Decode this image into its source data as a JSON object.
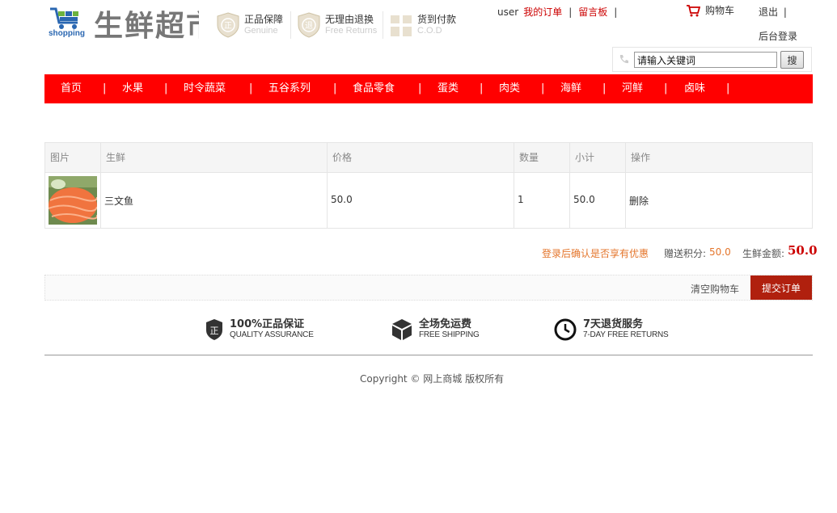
{
  "header": {
    "logo_en": "shopping",
    "logo_cn": "生鲜超市",
    "promises": [
      {
        "cn": "正品保障",
        "en": "Genuine",
        "icon": "shield-zheng-icon"
      },
      {
        "cn": "无理由退换",
        "en": "Free Returns",
        "icon": "shield-tui-icon"
      },
      {
        "cn": "货到付款",
        "en": "C.O.D",
        "icon": "gift-box-icon"
      }
    ],
    "user": "user",
    "my_orders": "我的订单",
    "message_board": "留言板",
    "sep": "|",
    "cart": "购物车",
    "logout": "退出",
    "admin_login": "后台登录"
  },
  "search": {
    "value": "请输入关键词",
    "button": "搜"
  },
  "nav": {
    "items": [
      "首页",
      "水果",
      "时令蔬菜",
      "五谷系列",
      "食品零食",
      "蛋类",
      "肉类",
      "海鲜",
      "河鲜",
      "卤味"
    ],
    "sep": "|"
  },
  "cart_table": {
    "headers": [
      "图片",
      "生鲜",
      "价格",
      "数量",
      "小计",
      "操作"
    ],
    "rows": [
      {
        "name": "三文鱼",
        "price": "50.0",
        "qty": "1",
        "subtotal": "50.0",
        "action": "删除",
        "image": "salmon-sashimi-photo"
      }
    ]
  },
  "summary": {
    "promo": "登录后确认是否享有优惠",
    "points_label": "赠送积分:",
    "points_value": "50.0",
    "total_label": "生鲜金额:",
    "total_value": "50.0"
  },
  "actions": {
    "clear": "清空购物车",
    "submit": "提交订单"
  },
  "guarantees": [
    {
      "cn": "100%正品保证",
      "en": "QUALITY ASSURANCE",
      "icon": "shield-icon"
    },
    {
      "cn": "全场免运费",
      "en": "FREE SHIPPING",
      "icon": "box-icon"
    },
    {
      "cn": "7天退货服务",
      "en": "7-DAY FREE RETURNS",
      "icon": "clock-icon"
    }
  ],
  "footer": {
    "copyright": "Copyright © 网上商城 版权所有"
  },
  "colors": {
    "nav_bg": "#ff0000",
    "accent_red": "#c00000",
    "submit_bg": "#b0200e",
    "promo_orange": "#e4752b"
  }
}
